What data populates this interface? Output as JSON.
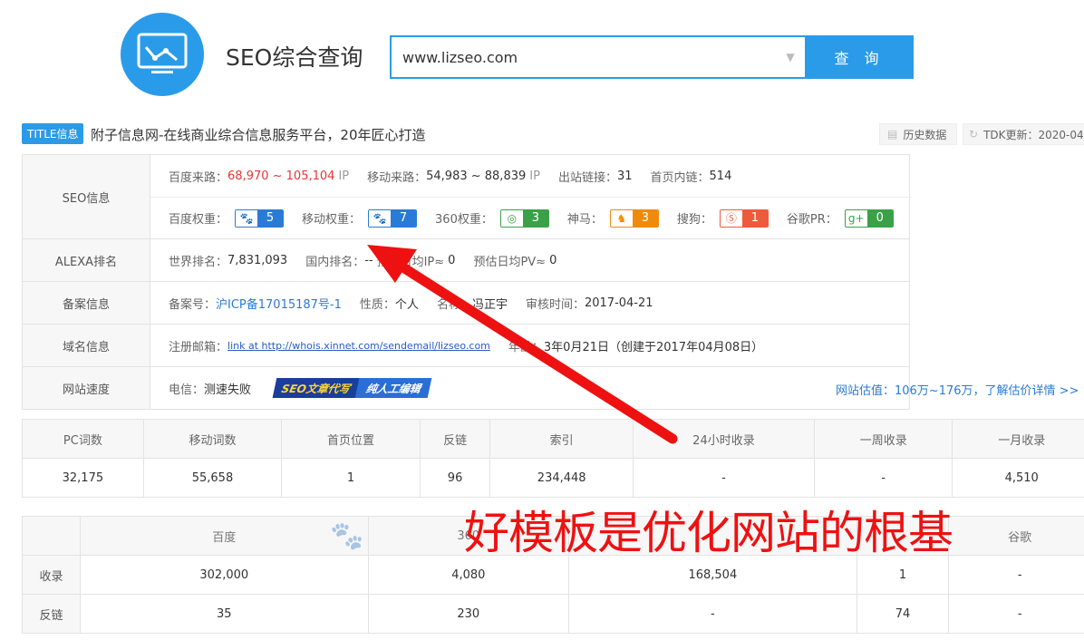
{
  "header": {
    "site_title": "SEO综合查询",
    "search_value": "www.lizseo.com",
    "search_button": "查 询"
  },
  "title_row": {
    "badge": "TITLE信息",
    "text": "附子信息网-在线商业综合信息服务平台，20年匠心打造",
    "history_btn": "历史数据",
    "tdk_btn": "TDK更新：2020-04"
  },
  "seo_info": {
    "label": "SEO信息",
    "baidu_traffic_label": "百度来路：",
    "baidu_traffic_value": "68,970 ~ 105,104",
    "ip1": "IP",
    "mobile_traffic_label": "移动来路：",
    "mobile_traffic_value": "54,983 ~ 88,839",
    "ip2": "IP",
    "outlinks_label": "出站链接：",
    "outlinks_value": "31",
    "homepage_links_label": "首页内链：",
    "homepage_links_value": "514",
    "weights": [
      {
        "label": "百度权重：",
        "value": "5",
        "color": "#2a7bd6",
        "icon": "paw-icon"
      },
      {
        "label": "移动权重：",
        "value": "7",
        "color": "#2a7bd6",
        "icon": "paw-icon"
      },
      {
        "label": "360权重：",
        "value": "3",
        "color": "#3aa148",
        "icon": "360-icon"
      },
      {
        "label": "神马：",
        "value": "3",
        "color": "#f08a0b",
        "icon": "shenma-icon"
      },
      {
        "label": "搜狗：",
        "value": "1",
        "color": "#ef5a3c",
        "icon": "sogou-icon"
      },
      {
        "label": "谷歌PR：",
        "value": "0",
        "color": "#3aa148",
        "icon": "google-plus-icon"
      }
    ]
  },
  "alexa": {
    "label": "ALEXA排名",
    "world_label": "世界排名：",
    "world_value": "7,831,093",
    "domestic_label": "国内排名：",
    "domestic_value": "--",
    "daily_ip_label": "预估日均IP≈",
    "daily_ip_value": "0",
    "daily_pv_label": "预估日均PV≈",
    "daily_pv_value": "0"
  },
  "icp": {
    "label": "备案信息",
    "number_label": "备案号：",
    "number_value": "沪ICP备17015187号-1",
    "nature_label": "性质：",
    "nature_value": "个人",
    "name_label": "名称：",
    "name_value": "冯正宇",
    "review_label": "审核时间：",
    "review_value": "2017-04-21"
  },
  "domain": {
    "label": "域名信息",
    "email_label": "注册邮箱：",
    "email_value": "link at http://whois.xinnet.com/sendemail/lizseo.com",
    "age_label": "年龄：",
    "age_value": "3年0月21日（创建于2017年04月08日）"
  },
  "speed": {
    "label": "网站速度",
    "telecom_label": "电信：",
    "telecom_value": "测速失败",
    "banner_part1": "SEO文章代写",
    "banner_part2": "纯人工编辑",
    "valuation": "网站估值：106万~176万，了解估价详情 >>"
  },
  "stats": {
    "headers": [
      "PC词数",
      "移动词数",
      "首页位置",
      "反链",
      "索引",
      "24小时收录",
      "一周收录",
      "一月收录"
    ],
    "values": [
      "32,175",
      "55,658",
      "1",
      "96",
      "234,448",
      "-",
      "-",
      "4,510"
    ]
  },
  "engines": {
    "headers": [
      "百度",
      "360",
      "",
      "",
      "谷歌"
    ],
    "rows": [
      {
        "label": "收录",
        "values": [
          "302,000",
          "4,080",
          "168,504",
          "1",
          "-"
        ]
      },
      {
        "label": "反链",
        "values": [
          "35",
          "230",
          "-",
          "74",
          "-"
        ]
      }
    ]
  },
  "overlay": {
    "text": "好模板是优化网站的根基"
  },
  "colors": {
    "accent": "#2a9be8",
    "traffic_red": "#ee3333",
    "overlay_red": "#ee1111"
  }
}
